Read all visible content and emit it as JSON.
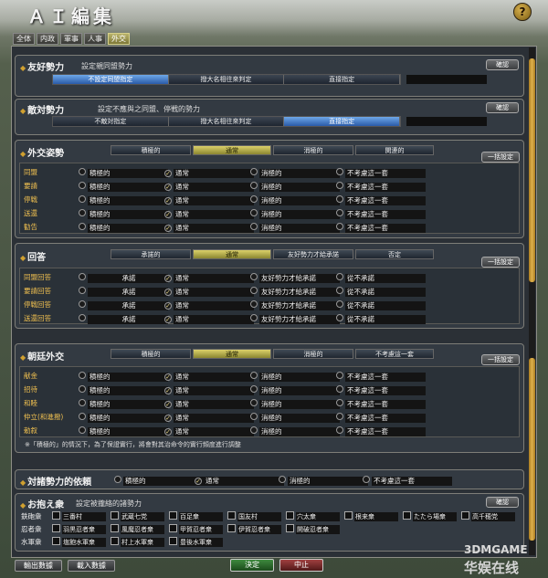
{
  "window": {
    "title": "ＡＩ編集",
    "help": "?"
  },
  "tabs": [
    "全体",
    "内政",
    "軍事",
    "人事",
    "外交"
  ],
  "friendly": {
    "title": "友好勢力",
    "desc": "設定親同盟勢力",
    "btn": "確認",
    "opts": [
      "不設定同盟指定",
      "撥大名相往來判定",
      "直接指定"
    ]
  },
  "hostile": {
    "title": "敵対勢力",
    "desc": "設定不應與之同盟、停戦的勢力",
    "btn": "確認",
    "opts": [
      "不敵対指定",
      "撥大名相往來判定",
      "直接指定"
    ]
  },
  "diplomacy": {
    "title": "外交姿勢",
    "btn": "一括設定",
    "headers": [
      "積極的",
      "通常",
      "消極的",
      "関連的"
    ],
    "rows": [
      {
        "label": "同盟",
        "opts": [
          "積極的",
          "通常",
          "消極的",
          "不考慮這一套"
        ]
      },
      {
        "label": "要請",
        "opts": [
          "積極的",
          "通常",
          "消極的",
          "不考慮這一套"
        ]
      },
      {
        "label": "停戦",
        "opts": [
          "積極的",
          "通常",
          "消極的",
          "不考慮這一套"
        ]
      },
      {
        "label": "送還",
        "opts": [
          "積極的",
          "通常",
          "消極的",
          "不考慮這一套"
        ]
      },
      {
        "label": "勧告",
        "opts": [
          "積極的",
          "通常",
          "消極的",
          "不考慮這一套"
        ]
      }
    ]
  },
  "answer": {
    "title": "回答",
    "btn": "一括設定",
    "headers": [
      "承諾的",
      "通常",
      "友好勢力才給承諾",
      "否定"
    ],
    "rows": [
      {
        "label": "同盟回答",
        "opts": [
          "承諾",
          "通常",
          "友好勢力才給承諾",
          "從不承諾"
        ]
      },
      {
        "label": "要請回答",
        "opts": [
          "承諾",
          "通常",
          "友好勢力才給承諾",
          "從不承諾"
        ]
      },
      {
        "label": "停戦回答",
        "opts": [
          "承諾",
          "通常",
          "友好勢力才給承諾",
          "從不承諾"
        ]
      },
      {
        "label": "送還回答",
        "opts": [
          "承諾",
          "通常",
          "友好勢力才給承諾",
          "從不承諾"
        ]
      }
    ]
  },
  "court": {
    "title": "朝廷外交",
    "btn": "一括設定",
    "headers": [
      "積極的",
      "通常",
      "消極的",
      "不考慮這一套"
    ],
    "rows": [
      {
        "label": "献金",
        "opts": [
          "積極的",
          "通常",
          "消極的",
          "不考慮這一套"
        ]
      },
      {
        "label": "招待",
        "opts": [
          "積極的",
          "通常",
          "消極的",
          "不考慮這一套"
        ]
      },
      {
        "label": "和睦",
        "opts": [
          "積極的",
          "通常",
          "消極的",
          "不考慮這一套"
        ]
      },
      {
        "label": "仲立(和進撥)",
        "opts": [
          "積極的",
          "通常",
          "消極的",
          "不考慮這一套"
        ]
      },
      {
        "label": "勅叙",
        "opts": [
          "積極的",
          "通常",
          "消極的",
          "不考慮這一套"
        ]
      }
    ],
    "note": "※「積極的」的情況下，為了保證實行，將會對其治命令的實行頻度進行調整"
  },
  "reliance": {
    "title": "対諸勢力的依頼",
    "opts": [
      "積極的",
      "通常",
      "消極的",
      "不考慮這一套"
    ]
  },
  "retainers": {
    "title": "お抱え衆",
    "desc": "設定被攏絡的諸勢力",
    "btn": "確認",
    "rows": [
      {
        "label": "鉄砲衆",
        "items": [
          "三番村",
          "武蔵七党",
          "百足衆",
          "国友村",
          "穴太衆",
          "根来衆",
          "たたら場衆",
          "高千穂党"
        ]
      },
      {
        "label": "忍者衆",
        "items": [
          "羽黒忍者衆",
          "風魔忍者衆",
          "甲賀忍者衆",
          "伊賀忍者衆",
          "開破忍者衆"
        ]
      },
      {
        "label": "水軍衆",
        "items": [
          "塩飽水軍衆",
          "村上水軍衆",
          "豊後水軍衆"
        ]
      }
    ]
  },
  "footer": {
    "export": "輸出數據",
    "import": "載入數據",
    "ok": "決定",
    "cancel": "中止"
  },
  "watermark": {
    "line1": "3DMGAME",
    "line2": "华娱在线"
  }
}
